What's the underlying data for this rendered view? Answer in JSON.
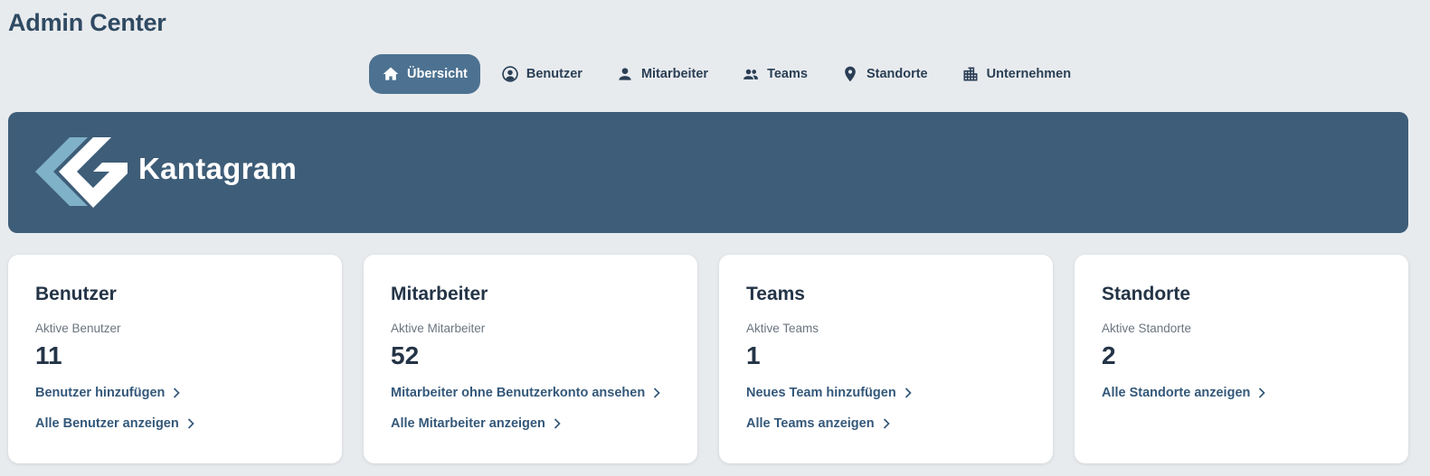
{
  "app": {
    "title": "Admin Center"
  },
  "nav": {
    "items": [
      {
        "label": "Übersicht",
        "icon": "home-icon",
        "active": true
      },
      {
        "label": "Benutzer",
        "icon": "user-circle-icon",
        "active": false
      },
      {
        "label": "Mitarbeiter",
        "icon": "person-icon",
        "active": false
      },
      {
        "label": "Teams",
        "icon": "group-icon",
        "active": false
      },
      {
        "label": "Standorte",
        "icon": "location-pin-icon",
        "active": false
      },
      {
        "label": "Unternehmen",
        "icon": "building-icon",
        "active": false
      }
    ]
  },
  "banner": {
    "brand": "Kantagram",
    "background_color": "#3e5d78",
    "logo_colors": {
      "front": "#ffffff",
      "back": "#7fb1c9"
    }
  },
  "cards": [
    {
      "title": "Benutzer",
      "subtitle": "Aktive Benutzer",
      "count": "11",
      "links": [
        "Benutzer hinzufügen",
        "Alle Benutzer anzeigen"
      ]
    },
    {
      "title": "Mitarbeiter",
      "subtitle": "Aktive Mitarbeiter",
      "count": "52",
      "links": [
        "Mitarbeiter ohne Benutzerkonto ansehen",
        "Alle Mitarbeiter anzeigen"
      ]
    },
    {
      "title": "Teams",
      "subtitle": "Aktive Teams",
      "count": "1",
      "links": [
        "Neues Team hinzufügen",
        "Alle Teams anzeigen"
      ]
    },
    {
      "title": "Standorte",
      "subtitle": "Aktive Standorte",
      "count": "2",
      "links": [
        "Alle Standorte anzeigen"
      ]
    }
  ],
  "colors": {
    "page_background": "#e8ebee",
    "accent": "#4d7291",
    "link": "#34587a",
    "text": "#243447"
  }
}
